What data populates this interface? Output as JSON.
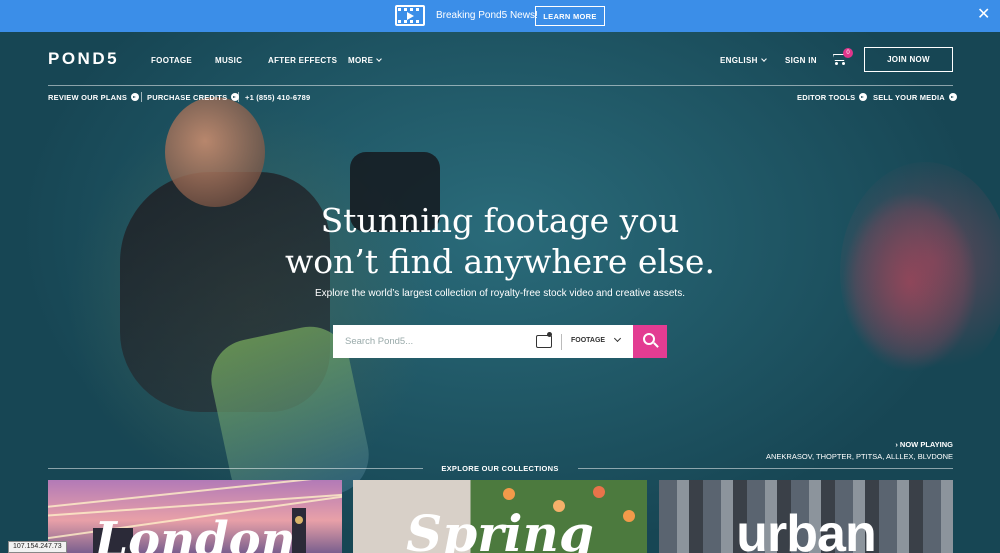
{
  "announcement": {
    "text": "Breaking Pond5 News!",
    "button_label": "LEARN MORE",
    "close_glyph": "✕",
    "background_color": "#3b8ee8"
  },
  "header": {
    "logo": "POND5",
    "nav": [
      "FOOTAGE",
      "MUSIC",
      "AFTER EFFECTS",
      "MORE"
    ],
    "language": "ENGLISH",
    "sign_in": "SIGN IN",
    "cart_count": "0",
    "join_label": "JOIN NOW",
    "cart_badge_color": "#e0358b"
  },
  "subnav": {
    "review_plans": "REVIEW OUR PLANS",
    "purchase_credits": "PURCHASE CREDITS",
    "phone": "+1 (855) 410-6789",
    "editor_tools": "EDITOR TOOLS",
    "sell_media": "SELL YOUR MEDIA"
  },
  "hero": {
    "headline_line1": "Stunning footage you",
    "headline_line2": "won’t find anywhere else.",
    "subheadline": "Explore the world’s largest collection of royalty-free stock video and creative assets."
  },
  "search": {
    "placeholder": "Search Pond5...",
    "type_selected": "FOOTAGE",
    "button_color": "#e33c92",
    "icons": [
      "visual-search-icon",
      "search-icon"
    ]
  },
  "now_playing": {
    "label": "› NOW PLAYING",
    "credits": "ANEKRASOV, THOPTER, PTITSA, ALLLEX, BLVDONE"
  },
  "collections": {
    "title": "EXPLORE OUR COLLECTIONS",
    "tiles": [
      {
        "label": "London"
      },
      {
        "label": "Spring"
      },
      {
        "label": "urban"
      }
    ]
  },
  "status": {
    "ip": "107.154.247.73"
  }
}
